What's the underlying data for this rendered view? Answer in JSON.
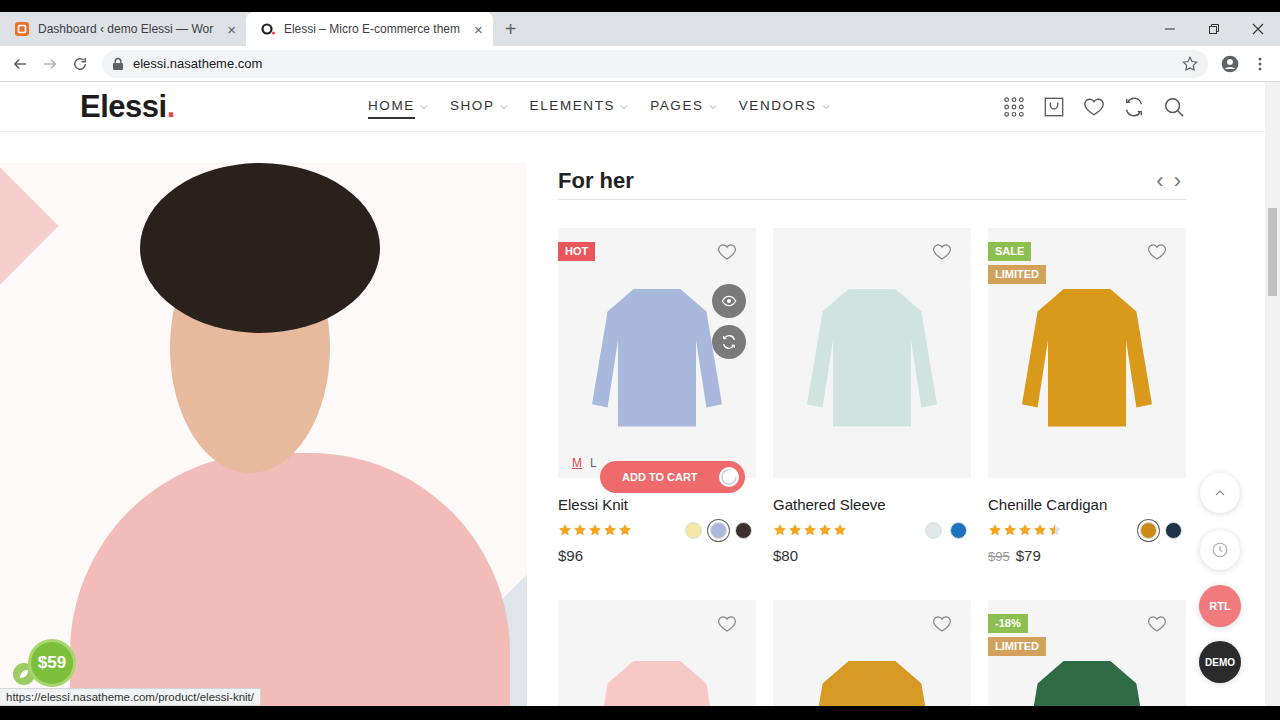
{
  "browser": {
    "tabs": [
      {
        "label": "Dashboard ‹ demo Elessi — Wor",
        "selected": false,
        "close": "×"
      },
      {
        "label": "Elessi – Micro E-commerce them",
        "selected": true,
        "close": "×"
      }
    ],
    "new_tab": "+",
    "url": "elessi.nasatheme.com",
    "status_url": "https://elessi.nasatheme.com/product/elessi-knit/"
  },
  "site": {
    "logo": "Elessi",
    "logo_dot": ".",
    "nav": [
      {
        "label": "HOME",
        "selected": true
      },
      {
        "label": "SHOP",
        "selected": false
      },
      {
        "label": "ELEMENTS",
        "selected": false
      },
      {
        "label": "PAGES",
        "selected": false
      },
      {
        "label": "VENDORS",
        "selected": false
      }
    ]
  },
  "section": {
    "title": "For her",
    "prev": "‹",
    "next": "›"
  },
  "products": [
    {
      "name": "Elessi Knit",
      "stars": 5,
      "price": "$96",
      "badges": [
        {
          "label": "HOT",
          "color": "#e8575a"
        }
      ],
      "swatches": [
        {
          "color": "#f3e6a6",
          "selected": false
        },
        {
          "color": "#aab8dc",
          "selected": true
        },
        {
          "color": "#3a3030",
          "selected": false
        }
      ],
      "hovered": true,
      "sizes": [
        {
          "label": "M",
          "selected": true
        },
        {
          "label": "L",
          "selected": false
        }
      ],
      "cart_button": "ADD TO CART",
      "loading": true
    },
    {
      "name": "Gathered Sleeve",
      "stars": 5,
      "price": "$80",
      "badges": [],
      "swatches": [
        {
          "color": "#dfe9e8",
          "selected": false
        },
        {
          "color": "#1e73be",
          "selected": false
        }
      ],
      "hovered": false
    },
    {
      "name": "Chenille Cardigan",
      "stars": 4.5,
      "old_price": "$95",
      "price": "$79",
      "badges": [
        {
          "label": "SALE",
          "color": "#8cc152"
        },
        {
          "label": "LIMITED",
          "color": "#d3a15c"
        }
      ],
      "swatches": [
        {
          "color": "#c98a18",
          "selected": true
        },
        {
          "color": "#1d3448",
          "selected": false
        }
      ],
      "hovered": false
    },
    {
      "badges": [],
      "hovered": false
    },
    {
      "badges": [],
      "hovered": false
    },
    {
      "badges": [
        {
          "label": "-18%",
          "color": "#8cc152"
        },
        {
          "label": "LIMITED",
          "color": "#d3a15c"
        }
      ],
      "hovered": false
    }
  ],
  "floating": {
    "rtl": "RTL",
    "demo": "DEMO",
    "cart_total": "$59"
  }
}
